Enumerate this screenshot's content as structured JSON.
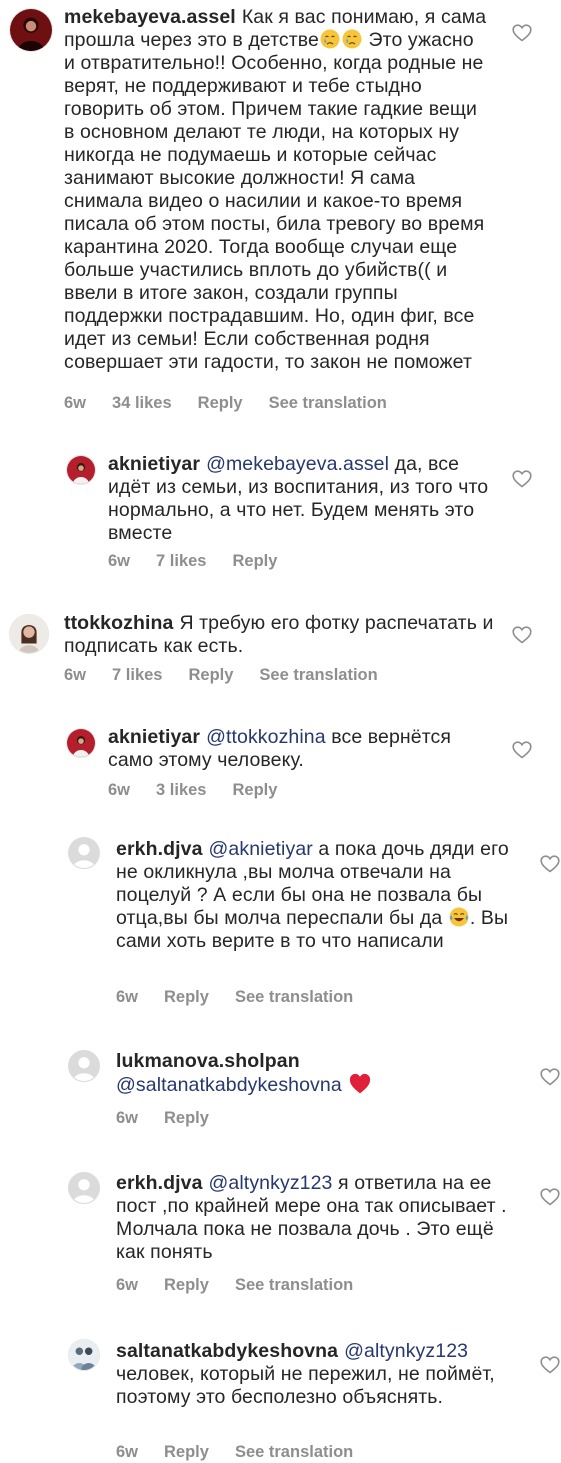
{
  "comments": [
    {
      "username": "mekebayeva.assel",
      "text": "Как я вас понимаю, я сама прошла через это в детстве",
      "emojis": [
        "crying-face",
        "crying-face"
      ],
      "text_after": "Это ужасно и отвратительно!! Особенно, когда родные не верят, не поддерживают и тебе стыдно говорить об этом. Причем такие гадкие вещи в основном делают те люди, на которых ну никогда не подумаешь и которые сейчас занимают высокие должности! Я сама снимала видео о насилии и какое-то время писала об этом посты, била тревогу во время карантина 2020. Тогда вообще случаи еще больше участились вплоть до убийств(( и ввели в итоге закон, создали группы поддержки пострадавшим. Но, один фиг, все идет из семьи! Если собственная родня совершает эти гадости, то закон не поможет",
      "time": "6w",
      "likes": "34 likes",
      "reply": "Reply",
      "translation": "See translation"
    },
    {
      "username": "aknietiyar",
      "mention": "@mekebayeva.assel",
      "text": "да, все идёт из семьи, из воспитания, из того что нормально, а что нет. Будем менять это вместе",
      "time": "6w",
      "likes": "7 likes",
      "reply": "Reply"
    },
    {
      "username": "ttokkozhina",
      "text": "Я требую его фотку распечатать и подписать как есть.",
      "time": "6w",
      "likes": "7 likes",
      "reply": "Reply",
      "translation": "See translation"
    },
    {
      "username": "aknietiyar",
      "mention": "@ttokkozhina",
      "text": "все вернётся само этому человеку.",
      "time": "6w",
      "likes": "3 likes",
      "reply": "Reply"
    },
    {
      "username": "erkh.djva",
      "mention": "@aknietiyar",
      "text": "а пока дочь дяди его не окликнула ,вы молча отвечали на поцелуй ? А если бы она не позвала бы отца,вы бы молча переспали бы да",
      "emojis": [
        "tears-of-joy"
      ],
      "text_after": ". Вы сами хоть верите в то что написали",
      "time": "6w",
      "reply": "Reply",
      "translation": "See translation"
    },
    {
      "username": "lukmanova.sholpan",
      "mention": "@saltanatkabdykeshovna",
      "emojis": [
        "red-heart"
      ],
      "time": "6w",
      "reply": "Reply"
    },
    {
      "username": "erkh.djva",
      "mention": "@altynkyz123",
      "text": "я ответила на ее пост ,по крайней мере она так описывает . Молчала пока не позвала дочь . Это ещё как понять",
      "time": "6w",
      "reply": "Reply",
      "translation": "See translation"
    },
    {
      "username": "saltanatkabdykeshovna",
      "mention": "@altynkyz123",
      "text": "человек, который не пережил, не поймёт, поэтому это бесполезно объяснять.",
      "time": "6w",
      "reply": "Reply",
      "translation": "See translation"
    }
  ],
  "colors": {
    "text": "#262626",
    "muted": "#8e8e8e",
    "mention": "#27386e",
    "heart_outline": "#8e8e8e",
    "red_heart": "#e0203a"
  }
}
